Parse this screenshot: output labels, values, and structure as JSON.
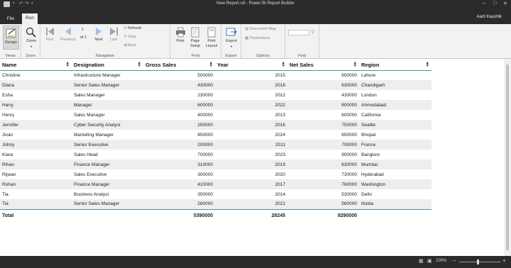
{
  "window": {
    "title": "New Report.rdl - Power BI Report Builder",
    "user": "Aarti Kaushik"
  },
  "tabs": [
    "File",
    "Run"
  ],
  "ribbon": {
    "views": {
      "design": "Design",
      "group": "Views"
    },
    "zoom": {
      "zoom": "Zoom",
      "group": "Zoom"
    },
    "navigation": {
      "first": "First",
      "previous": "Previous",
      "page_current": "1",
      "page_of": "of",
      "page_total": "1",
      "next": "Next",
      "last": "Last",
      "refresh": "Refresh",
      "stop": "Stop",
      "back": "Back",
      "group": "Navigation"
    },
    "print": {
      "print": "Print",
      "page_setup_1": "Page",
      "page_setup_2": "Setup",
      "print_layout_1": "Print",
      "print_layout_2": "Layout",
      "group": "Print"
    },
    "export": {
      "export": "Export",
      "group": "Export"
    },
    "options": {
      "document_map": "Document Map",
      "parameters": "Parameters",
      "group": "Options"
    },
    "find": {
      "group": "Find",
      "value": ""
    }
  },
  "table": {
    "headers": [
      "Name",
      "Designation",
      "Gross Sales",
      "Year",
      "Net Sales",
      "Region"
    ],
    "rows": [
      [
        "Christine",
        "Infrastructure Manager",
        "500000",
        "2015",
        "650000",
        "Lahore"
      ],
      [
        "Diana",
        "Senior Sales Manager",
        "430000",
        "2018",
        "630000",
        "Chandigarh"
      ],
      [
        "Esha",
        "Sales Manager",
        "230000",
        "2012",
        "430000",
        "London"
      ],
      [
        "Harry",
        "Manager",
        "600000",
        "2022",
        "800000",
        "Ahmedabad"
      ],
      [
        "Henry",
        "Sales Manager",
        "400000",
        "2013",
        "600000",
        "California"
      ],
      [
        "Jennifer",
        "Cyber Security Analyst",
        "250000",
        "2016",
        "750000",
        "Seattle"
      ],
      [
        "Jivan",
        "Marketing Manager",
        "450000",
        "2024",
        "650000",
        "Bhopal"
      ],
      [
        "Johny",
        "Senior Executive",
        "200000",
        "2011",
        "700000",
        "France"
      ],
      [
        "Kiara",
        "Sales Head",
        "700000",
        "2023",
        "900000",
        "Banglore"
      ],
      [
        "Rihan",
        "Finance Manager",
        "310000",
        "2019",
        "630000",
        "Mumbai"
      ],
      [
        "Rijwan",
        "Sales Executive",
        "300000",
        "2020",
        "730000",
        "Hyderabad"
      ],
      [
        "Rohan",
        "Finance Manager",
        "410000",
        "2017",
        "760000",
        "Washington"
      ],
      [
        "Tia",
        "Business Analyst",
        "350000",
        "2014",
        "530000",
        "Delhi"
      ],
      [
        "Tia",
        "Senior Sales Manager",
        "260000",
        "2021",
        "560000",
        "Noida"
      ]
    ],
    "total": {
      "label": "Total",
      "gross_sales": "5390000",
      "year": "28245",
      "net_sales": "9290000"
    }
  },
  "status": {
    "zoom": "100%"
  }
}
